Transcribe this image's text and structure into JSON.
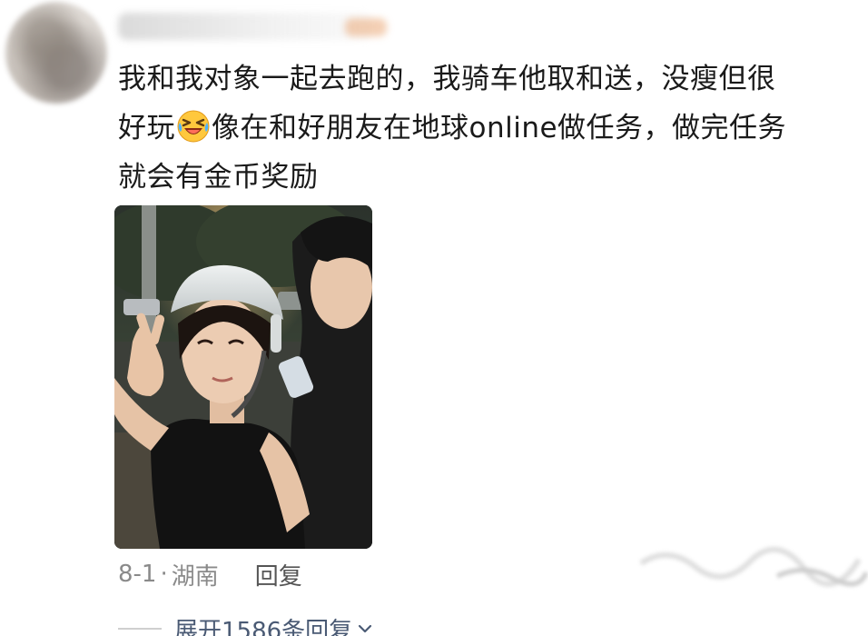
{
  "comment": {
    "line1": "我和我对象一起去跑的，我骑车他取和送，没瘦但很",
    "line2_before": "好玩",
    "line2_after": "像在和好朋友在地球online做任务，做完任务",
    "line3": "就会有金币奖励",
    "emoji_icon": "laughing-tears-emoji"
  },
  "meta": {
    "date": "8-1",
    "separator": "·",
    "location": "湖南",
    "reply_label": "回复"
  },
  "replies": {
    "expand_label": "展开1586条回复",
    "chevron_icon": "chevron-down-icon"
  },
  "colors": {
    "text_primary": "#1a1a1a",
    "text_meta": "#8a8a8a",
    "expand_link": "#4a5a74"
  }
}
